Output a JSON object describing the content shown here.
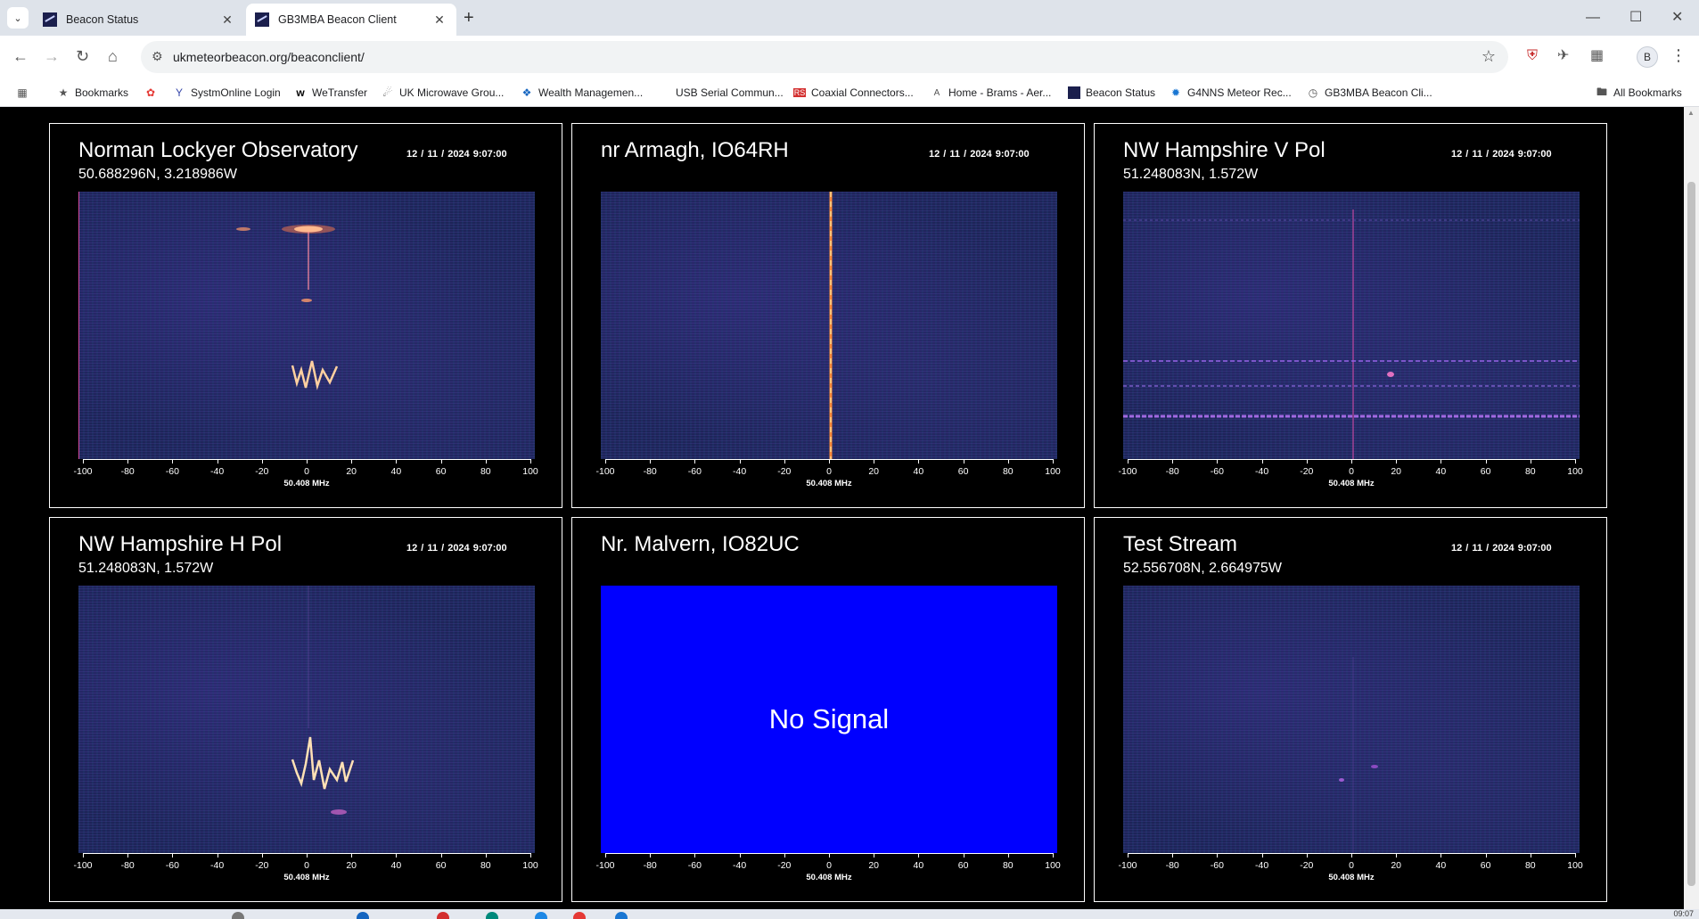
{
  "browser": {
    "tabs": [
      {
        "title": "Beacon Status"
      },
      {
        "title": "GB3MBA Beacon Client"
      }
    ],
    "url": "ukmeteorbeacon.org/beaconclient/",
    "profile_initial": "B"
  },
  "bookmarks": {
    "items": [
      {
        "label": "Bookmarks",
        "icon": "star-icon"
      },
      {
        "label": "",
        "icon": "colorful-logo-icon"
      },
      {
        "label": "SystmOnline Login",
        "icon": "y-logo-icon"
      },
      {
        "label": "WeTransfer",
        "icon": "we-logo-icon"
      },
      {
        "label": "UK Microwave Grou...",
        "icon": "dish-icon"
      },
      {
        "label": "Wealth Managemen...",
        "icon": "blue-logo-icon"
      },
      {
        "label": "USB Serial Commun...",
        "icon": "blank-icon"
      },
      {
        "label": "Coaxial Connectors...",
        "icon": "rs-logo-icon"
      },
      {
        "label": "Home - Brams - Aer...",
        "icon": "a-logo-icon"
      },
      {
        "label": "Beacon Status",
        "icon": "beacon-logo-icon"
      },
      {
        "label": "G4NNS Meteor Rec...",
        "icon": "g4nns-logo-icon"
      },
      {
        "label": "GB3MBA Beacon Cli...",
        "icon": "globe-icon"
      }
    ],
    "all_label": "All Bookmarks"
  },
  "panels": [
    {
      "title": "Norman Lockyer Observatory",
      "coords": "50.688296N, 3.218986W",
      "time": "12 / 11 / 2024  9:07:00"
    },
    {
      "title": "nr Armagh, IO64RH",
      "coords": "",
      "time": "12 / 11 / 2024  9:07:00"
    },
    {
      "title": "NW Hampshire V Pol",
      "coords": "51.248083N, 1.572W",
      "time": "12 / 11 / 2024  9:07:00"
    },
    {
      "title": "NW Hampshire H Pol",
      "coords": "51.248083N, 1.572W",
      "time": "12 / 11 / 2024  9:07:00"
    },
    {
      "title": "Nr. Malvern, IO82UC",
      "coords": "",
      "time": "",
      "no_signal": "No Signal"
    },
    {
      "title": "Test Stream",
      "coords": "52.556708N, 2.664975W",
      "time": "12 / 11 / 2024  9:07:00"
    }
  ],
  "axis": {
    "ticks": [
      "-100",
      "-80",
      "-60",
      "-40",
      "-20",
      "0",
      "20",
      "40",
      "60",
      "80",
      "100"
    ],
    "freq_label": "50.408 MHz"
  },
  "taskbar": {
    "clock": "09:07"
  }
}
